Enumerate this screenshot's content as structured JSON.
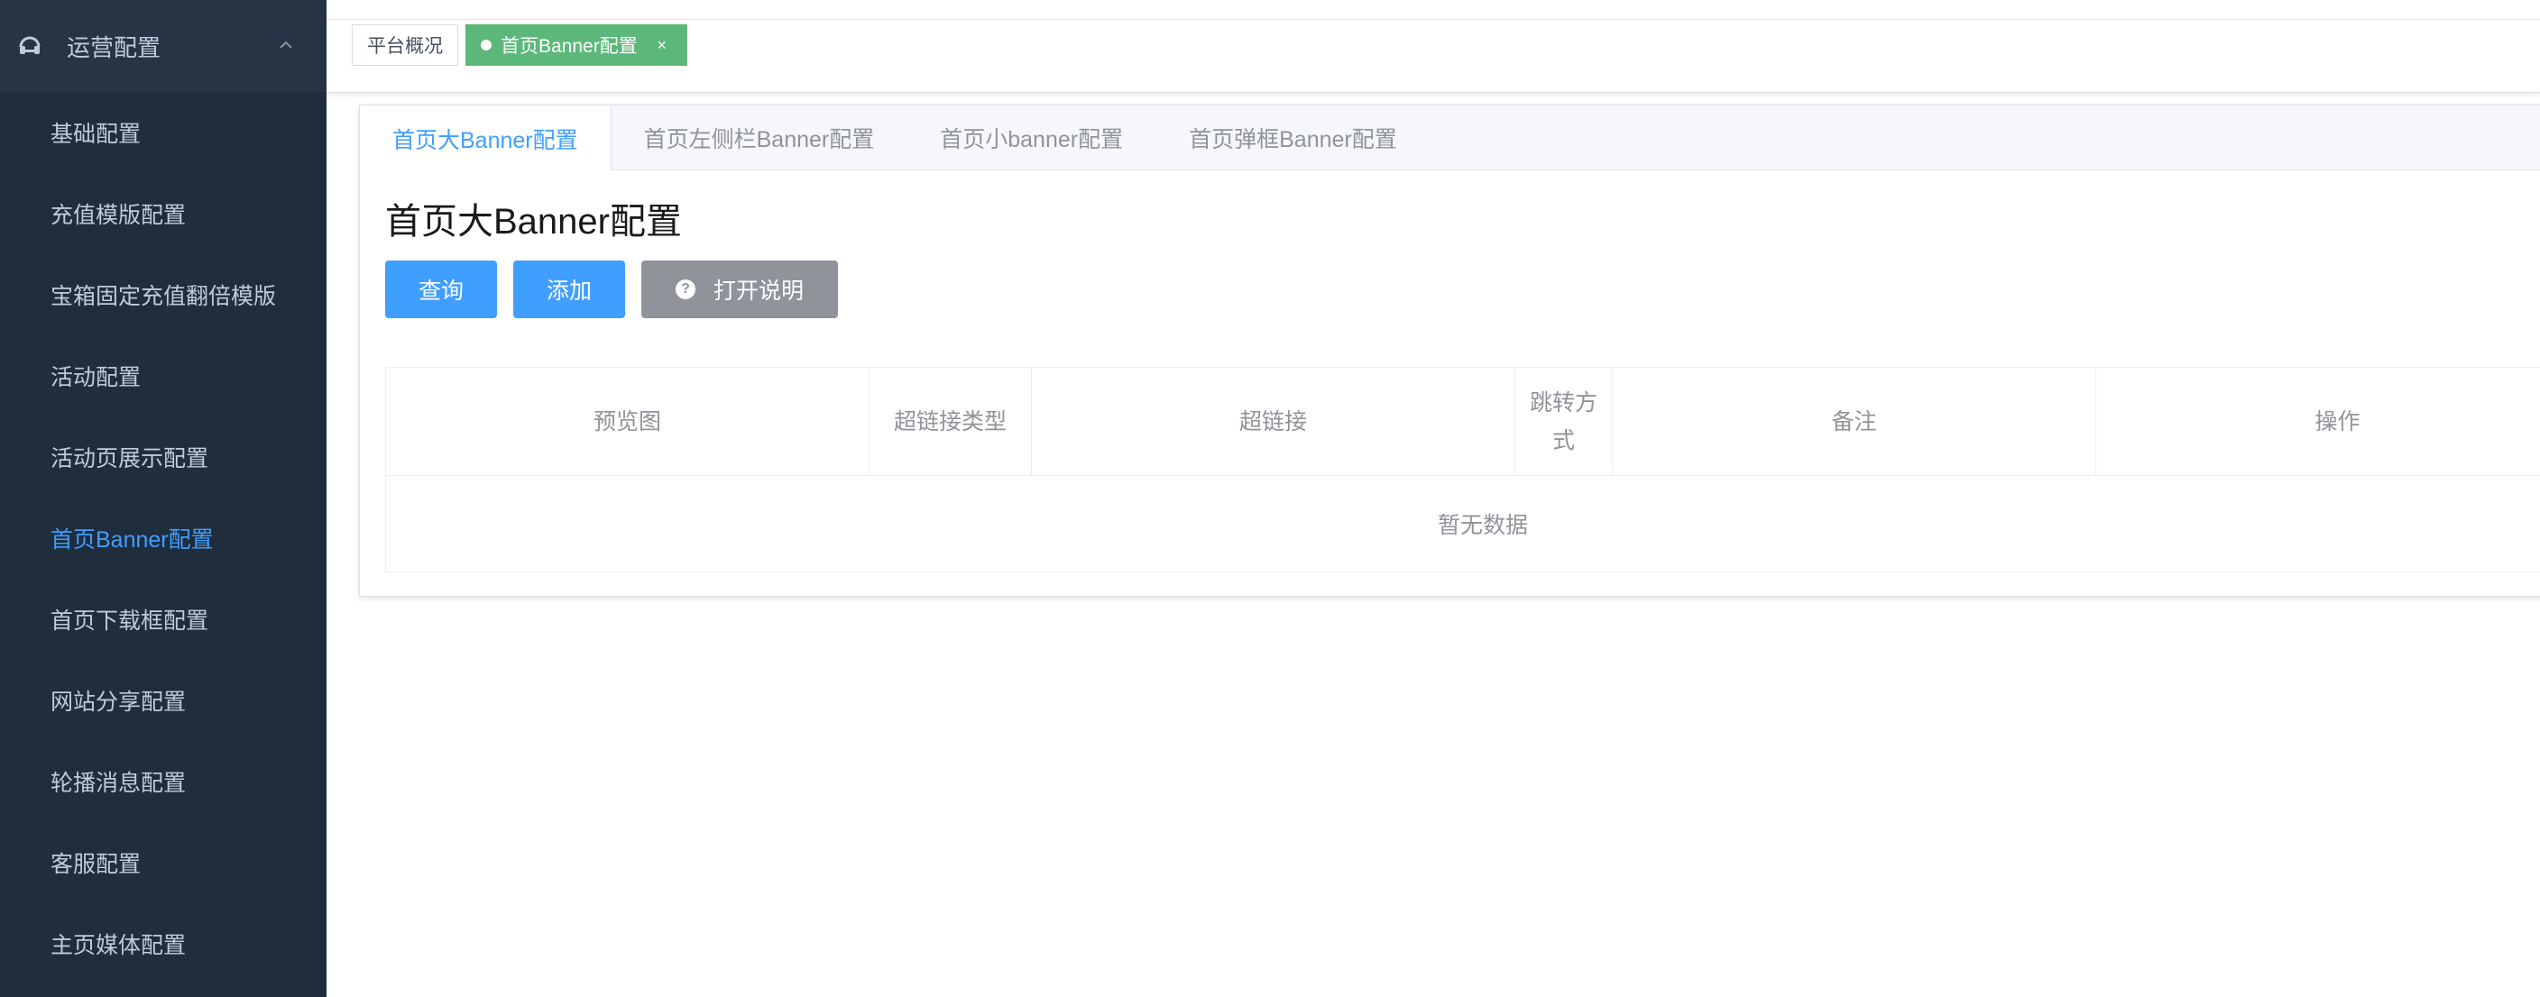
{
  "sidebar": {
    "section_title": "运营配置",
    "items": [
      {
        "label": "基础配置",
        "active": false
      },
      {
        "label": "充值模版配置",
        "active": false
      },
      {
        "label": "宝箱固定充值翻倍模版",
        "active": false
      },
      {
        "label": "活动配置",
        "active": false
      },
      {
        "label": "活动页展示配置",
        "active": false
      },
      {
        "label": "首页Banner配置",
        "active": true
      },
      {
        "label": "首页下载框配置",
        "active": false
      },
      {
        "label": "网站分享配置",
        "active": false
      },
      {
        "label": "轮播消息配置",
        "active": false
      },
      {
        "label": "客服配置",
        "active": false
      },
      {
        "label": "主页媒体配置",
        "active": false
      }
    ]
  },
  "tags": {
    "home_label": "平台概况",
    "active_label": "首页Banner配置",
    "close_glyph": "×"
  },
  "tabs": [
    {
      "label": "首页大Banner配置",
      "active": true
    },
    {
      "label": "首页左侧栏Banner配置",
      "active": false
    },
    {
      "label": "首页小banner配置",
      "active": false
    },
    {
      "label": "首页弹框Banner配置",
      "active": false
    }
  ],
  "panel": {
    "title": "首页大Banner配置",
    "buttons": {
      "query": "查询",
      "add": "添加",
      "help": "打开说明",
      "help_icon_glyph": "?"
    }
  },
  "table": {
    "columns": [
      "预览图",
      "超链接类型",
      "超链接",
      "跳转方式",
      "备注",
      "操作"
    ],
    "rows": [],
    "empty_text": "暂无数据"
  },
  "colors": {
    "sidebar_bg": "#1f2d3d",
    "active_menu": "#409eff",
    "active_tag": "#5cb87a",
    "primary_button": "#409eff",
    "info_button": "#909399"
  },
  "icons": {
    "section_icon": "headset-icon",
    "collapse_icon": "chevron-up-icon",
    "help_icon": "question-circle-icon",
    "tag_dot": "dot-icon",
    "tag_close": "close-icon"
  }
}
